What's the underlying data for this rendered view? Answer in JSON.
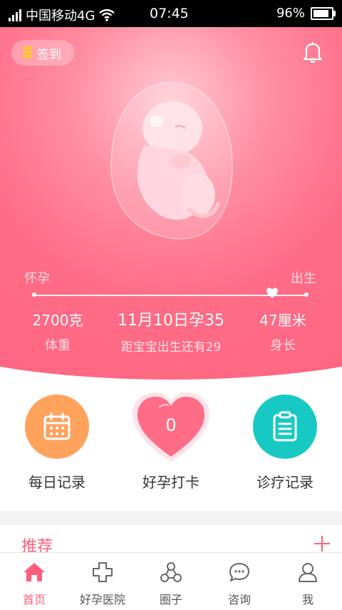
{
  "status_bar": {
    "carrier": "中国移动4G",
    "time": "07:45",
    "battery": "96%"
  },
  "checkin": {
    "label": "签到"
  },
  "progress": {
    "start_label": "怀孕",
    "end_label": "出生",
    "fraction": 0.87
  },
  "stats": {
    "weight_value": "2700克",
    "weight_label": "体重",
    "date_line": "11月10日孕35",
    "countdown": "距宝宝出生还有29",
    "length_value": "47厘米",
    "length_label": "身长"
  },
  "actions": {
    "daily": "每日记录",
    "clock_count": "0",
    "clock_label": "好孕打卡",
    "clinic": "诊疗记录"
  },
  "recommend": {
    "title": "推荐"
  },
  "tabs": [
    {
      "label": "首页",
      "icon": "home-icon",
      "active": true
    },
    {
      "label": "好孕医院",
      "icon": "hospital-cross-icon"
    },
    {
      "label": "圈子",
      "icon": "circle-group-icon"
    },
    {
      "label": "咨询",
      "icon": "chat-bubble-icon"
    },
    {
      "label": "我",
      "icon": "user-icon"
    }
  ],
  "colors": {
    "brand": "#ff5f7b",
    "daily": "#ffa25c",
    "clinic": "#17c9c4"
  }
}
